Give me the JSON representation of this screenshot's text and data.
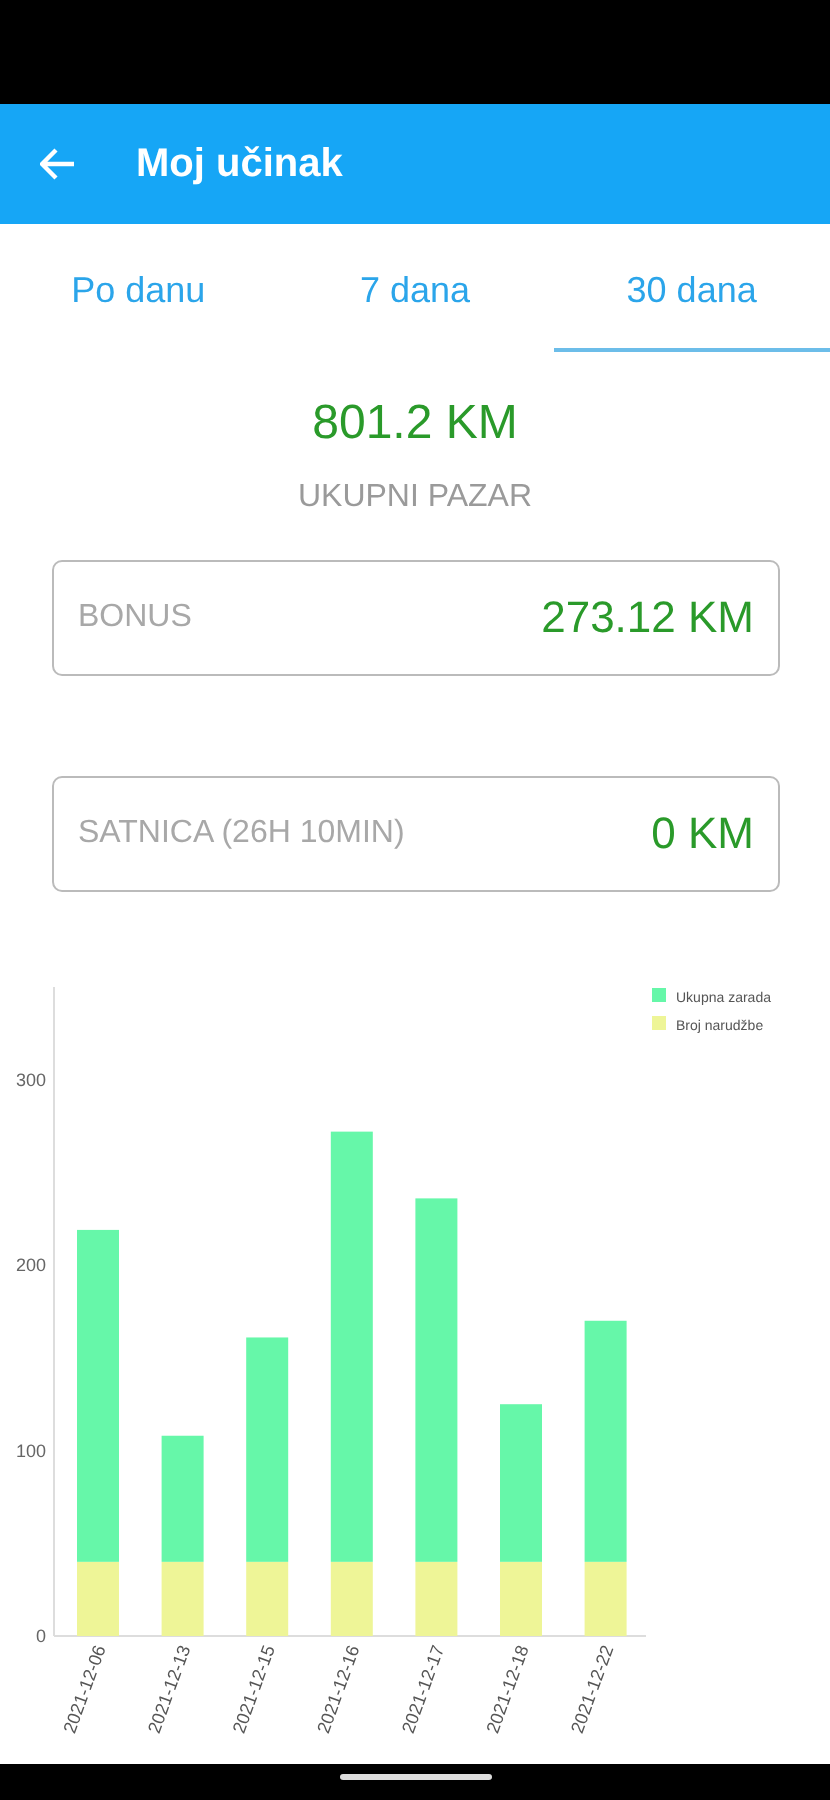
{
  "app_bar": {
    "title": "Moj učinak"
  },
  "tabs": [
    {
      "label": "Po danu",
      "selected": false
    },
    {
      "label": "7 dana",
      "selected": false
    },
    {
      "label": "30 dana",
      "selected": true
    }
  ],
  "total": {
    "amount": "801.2 KM",
    "label": "UKUPNI PAZAR"
  },
  "cards": [
    {
      "label": "BONUS",
      "value": "273.12 KM"
    },
    {
      "label": "SATNICA (26H 10MIN)",
      "value": "0 KM"
    }
  ],
  "chart_data": {
    "type": "bar",
    "stacked": true,
    "categories": [
      "2021-12-06",
      "2021-12-13",
      "2021-12-15",
      "2021-12-16",
      "2021-12-17",
      "2021-12-18",
      "2021-12-22"
    ],
    "series": [
      {
        "name": "Broj narudžbe",
        "color": "#eef597",
        "values": [
          40,
          40,
          40,
          40,
          40,
          40,
          40
        ]
      },
      {
        "name": "Ukupna zarada",
        "color": "#66f7a9",
        "values": [
          179,
          68,
          121,
          232,
          196,
          85,
          130
        ]
      }
    ],
    "ylim": [
      0,
      350
    ],
    "yticks": [
      0,
      100,
      200,
      300
    ],
    "legend": true
  }
}
